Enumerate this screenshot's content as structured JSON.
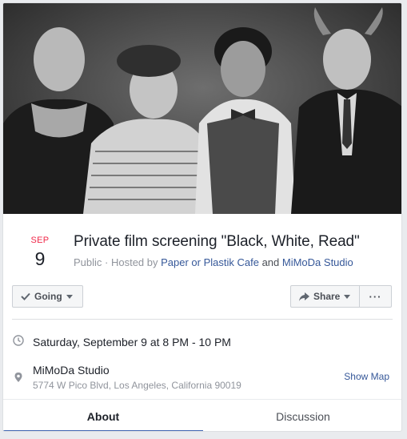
{
  "event": {
    "month": "SEP",
    "day": "9",
    "title": "Private film screening \"Black, White, Read\"",
    "privacy": "Public",
    "hosted_prefix": " · Hosted by ",
    "host_1": "Paper or Plastik Cafe",
    "host_joiner": " and ",
    "host_2": "MiMoDa Studio"
  },
  "actions": {
    "going_label": "Going",
    "share_label": "Share",
    "more_label": "···"
  },
  "details": {
    "time": "Saturday, September 9 at 8 PM - 10 PM",
    "place_name": "MiMoDa Studio",
    "place_address": "5774 W Pico Blvd, Los Angeles, California 90019",
    "show_map": "Show Map"
  },
  "tabs": [
    {
      "label": "About",
      "active": true
    },
    {
      "label": "Discussion",
      "active": false
    }
  ],
  "colors": {
    "month_red": "#f02849",
    "link_blue": "#365899",
    "tab_underline": "#4267b2"
  }
}
